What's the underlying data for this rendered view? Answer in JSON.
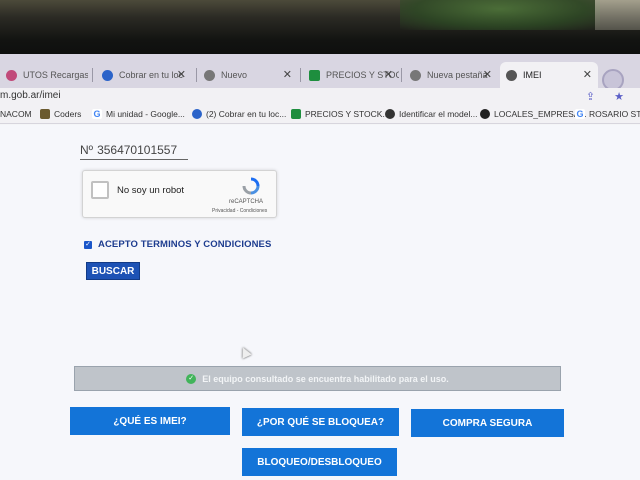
{
  "tabs": [
    {
      "label": "UTOS Recargas",
      "icon": "tab-favicon-icon",
      "color": "#c14a7a"
    },
    {
      "label": "Cobrar en tu loc",
      "icon": "mercadopago-icon",
      "color": "#2b63c9"
    },
    {
      "label": "Nuevo",
      "icon": "globe-icon",
      "color": "#777777"
    },
    {
      "label": "PRECIOS Y STOC",
      "icon": "sheets-icon",
      "color": "#1e8e3e"
    },
    {
      "label": "Nueva pestaña",
      "icon": "globe-icon",
      "color": "#777777"
    },
    {
      "label": "IMEI",
      "icon": "imei-favicon-icon",
      "color": "#555555"
    }
  ],
  "address": {
    "url": "m.gob.ar/imei"
  },
  "bookmarks": [
    {
      "label": "NACOM",
      "icon": "bookmark-icon",
      "color": "#777777"
    },
    {
      "label": "Coders",
      "icon": "coders-icon",
      "color": "#6b5a2e"
    },
    {
      "label": "Mi unidad - Google...",
      "icon": "google-icon",
      "color": "#4285f4"
    },
    {
      "label": "(2) Cobrar en tu loc...",
      "icon": "mercadopago-icon",
      "color": "#2b63c9"
    },
    {
      "label": "PRECIOS Y STOCK...",
      "icon": "sheets-icon",
      "color": "#1e8e3e"
    },
    {
      "label": "Identificar el model...",
      "icon": "apple-icon",
      "color": "#333333"
    },
    {
      "label": "LOCALES_EMPRESA...",
      "icon": "github-icon",
      "color": "#222222"
    },
    {
      "label": "ROSARIO STOCK",
      "icon": "google-icon",
      "color": "#4285f4"
    }
  ],
  "form": {
    "imei_prefix": "Nº",
    "imei_value": "356470101557",
    "captcha_label": "No soy un robot",
    "captcha_brand": "reCAPTCHA",
    "captcha_privacy": "Privacidad - Condiciones",
    "terms_label": "ACEPTO TERMINOS Y CONDICIONES",
    "search_button": "BUSCAR"
  },
  "alert": {
    "message": "El equipo consultado se encuentra habilitado para el uso."
  },
  "actions": {
    "what_is_imei": "¿QUÉ ES IMEI?",
    "why_block": "¿POR QUÉ SE BLOQUEA?",
    "safe_buy": "COMPRA SEGURA",
    "lock_unlock": "BLOQUEO/DESBLOQUEO"
  },
  "colors": {
    "primary_button": "#1374d8",
    "search_button": "#1d52b5",
    "success_icon": "#41b45a",
    "alert_bg": "#bfc4ca"
  }
}
